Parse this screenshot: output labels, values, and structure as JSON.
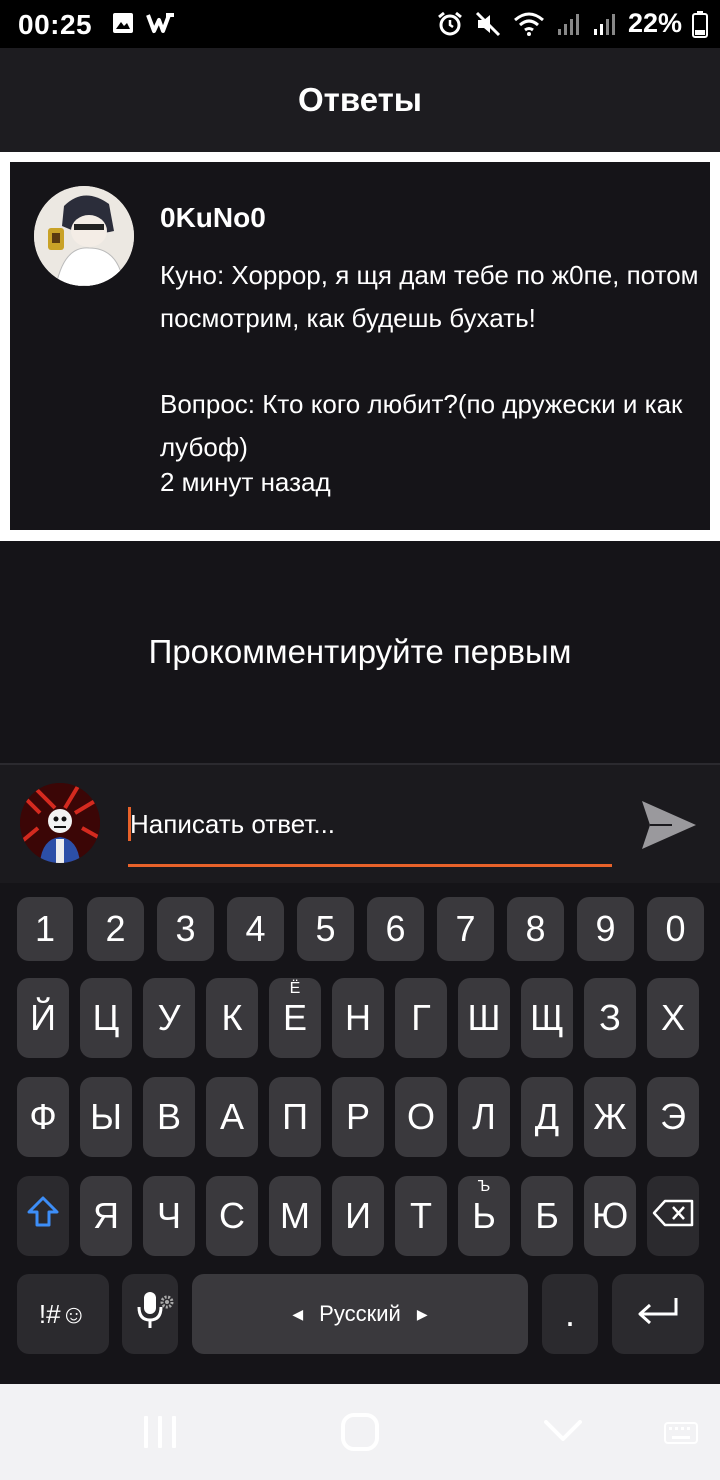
{
  "status_bar": {
    "time": "00:25",
    "battery": "22%",
    "icons": [
      "gallery-icon",
      "w-app-icon",
      "alarm-icon",
      "mute-icon",
      "wifi-icon",
      "signal-icon",
      "signal-icon",
      "battery-icon"
    ]
  },
  "header": {
    "title": "Ответы"
  },
  "post": {
    "author": "0KuNo0",
    "text": "Куно: Хоррор, я щя дам тебе по ж0пе, потом посмотрим, как будешь бухать!\n\nВопрос: Кто кого любит?(по дружески и как лубоф)",
    "time": "2 минут назад"
  },
  "empty_state": {
    "text": "Прокомментируйте первым"
  },
  "composer": {
    "placeholder": "Написать ответ..."
  },
  "keyboard": {
    "number_row": [
      "1",
      "2",
      "3",
      "4",
      "5",
      "6",
      "7",
      "8",
      "9",
      "0"
    ],
    "row1": [
      "Й",
      "Ц",
      "У",
      "К",
      "Е",
      "Н",
      "Г",
      "Ш",
      "Щ",
      "З",
      "Х"
    ],
    "row1_sup": {
      "e": "Ё"
    },
    "row2": [
      "Ф",
      "Ы",
      "В",
      "А",
      "П",
      "Р",
      "О",
      "Л",
      "Д",
      "Ж",
      "Э"
    ],
    "row3": [
      "Я",
      "Ч",
      "С",
      "М",
      "И",
      "Т",
      "Ь",
      "Б",
      "Ю"
    ],
    "row3_sup": {
      "soft": "Ъ"
    },
    "symbols_label": "!#☺",
    "space_label": "Русский",
    "period_label": ".",
    "accent_color": "#e8622a",
    "shift_color": "#3d8ef8"
  }
}
